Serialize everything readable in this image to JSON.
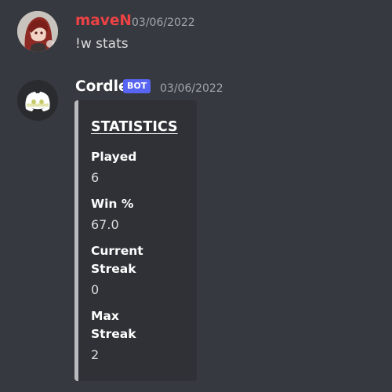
{
  "messages": [
    {
      "author": "maveN",
      "timestamp": "03/06/2022",
      "content": "!w stats",
      "author_color": "#ed4245"
    },
    {
      "author": "Cordle",
      "badge": "BOT",
      "timestamp": "03/06/2022",
      "embed": {
        "title": "STATISTICS",
        "fields": [
          {
            "name": "Played",
            "value": "6"
          },
          {
            "name": "Win %",
            "value": "67.0"
          },
          {
            "name": "Current Streak",
            "value": "0"
          },
          {
            "name": "Max Streak",
            "value": "2"
          }
        ]
      }
    }
  ],
  "icons": {
    "user_avatar": "anime-avatar-icon",
    "bot_avatar": "discord-logo-icon",
    "badge_color": "#5865f2",
    "embed_bar_color": "#b9bbbe"
  }
}
